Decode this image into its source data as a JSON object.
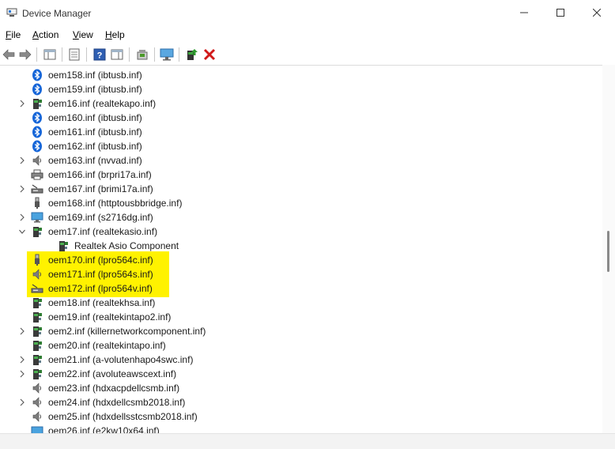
{
  "window": {
    "title": "Device Manager",
    "controls": {
      "minimize": "minimize-icon",
      "maximize": "maximize-icon",
      "close": "close-icon"
    }
  },
  "menu": [
    {
      "id": "file",
      "ul": "F",
      "rest": "ile"
    },
    {
      "id": "action",
      "ul": "A",
      "rest": "ction"
    },
    {
      "id": "view",
      "ul": "V",
      "rest": "iew"
    },
    {
      "id": "help",
      "ul": "H",
      "rest": "elp"
    }
  ],
  "toolbar": [
    {
      "id": "back",
      "icon": "back-arrow-icon"
    },
    {
      "id": "forward",
      "icon": "forward-arrow-icon"
    },
    {
      "id": "show-hide-console-tree",
      "icon": "console-tree-icon"
    },
    {
      "id": "properties",
      "icon": "properties-icon"
    },
    {
      "id": "help",
      "icon": "help-icon"
    },
    {
      "id": "action-pane",
      "icon": "action-pane-icon"
    },
    {
      "id": "update-driver",
      "icon": "update-driver-icon"
    },
    {
      "id": "scan-hardware",
      "icon": "monitor-scan-icon"
    },
    {
      "id": "enable-device",
      "icon": "enable-device-icon"
    },
    {
      "id": "uninstall-device",
      "icon": "uninstall-x-icon"
    }
  ],
  "tree": [
    {
      "label": "oem158.inf (ibtusb.inf)",
      "icon": "bluetooth",
      "level": 0,
      "expander": "none",
      "highlight": false
    },
    {
      "label": "oem159.inf (ibtusb.inf)",
      "icon": "bluetooth",
      "level": 0,
      "expander": "none",
      "highlight": false
    },
    {
      "label": "oem16.inf (realtekapo.inf)",
      "icon": "component",
      "level": 0,
      "expander": "collapsed",
      "highlight": false
    },
    {
      "label": "oem160.inf (ibtusb.inf)",
      "icon": "bluetooth",
      "level": 0,
      "expander": "none",
      "highlight": false
    },
    {
      "label": "oem161.inf (ibtusb.inf)",
      "icon": "bluetooth",
      "level": 0,
      "expander": "none",
      "highlight": false
    },
    {
      "label": "oem162.inf (ibtusb.inf)",
      "icon": "bluetooth",
      "level": 0,
      "expander": "none",
      "highlight": false
    },
    {
      "label": "oem163.inf (nvvad.inf)",
      "icon": "speaker",
      "level": 0,
      "expander": "collapsed",
      "highlight": false
    },
    {
      "label": "oem166.inf (brpri17a.inf)",
      "icon": "printer",
      "level": 0,
      "expander": "none",
      "highlight": false
    },
    {
      "label": "oem167.inf (brimi17a.inf)",
      "icon": "scanner",
      "level": 0,
      "expander": "collapsed",
      "highlight": false
    },
    {
      "label": "oem168.inf (httptousbbridge.inf)",
      "icon": "usb-plug",
      "level": 0,
      "expander": "none",
      "highlight": false
    },
    {
      "label": "oem169.inf (s2716dg.inf)",
      "icon": "monitor",
      "level": 0,
      "expander": "collapsed",
      "highlight": false
    },
    {
      "label": "oem17.inf (realtekasio.inf)",
      "icon": "component",
      "level": 0,
      "expander": "expanded",
      "highlight": false
    },
    {
      "label": "Realtek Asio Component",
      "icon": "component",
      "level": 1,
      "expander": "none",
      "highlight": false
    },
    {
      "label": "oem170.inf (lpro564c.inf)",
      "icon": "usb-plug",
      "level": 0,
      "expander": "none",
      "highlight": true
    },
    {
      "label": "oem171.inf (lpro564s.inf)",
      "icon": "speaker",
      "level": 0,
      "expander": "none",
      "highlight": true
    },
    {
      "label": "oem172.inf (lpro564v.inf)",
      "icon": "scanner",
      "level": 0,
      "expander": "none",
      "highlight": true
    },
    {
      "label": "oem18.inf (realtekhsa.inf)",
      "icon": "component",
      "level": 0,
      "expander": "none",
      "highlight": false
    },
    {
      "label": "oem19.inf (realtekintapo2.inf)",
      "icon": "component",
      "level": 0,
      "expander": "none",
      "highlight": false
    },
    {
      "label": "oem2.inf (killernetworkcomponent.inf)",
      "icon": "component",
      "level": 0,
      "expander": "collapsed",
      "highlight": false
    },
    {
      "label": "oem20.inf (realtekintapo.inf)",
      "icon": "component",
      "level": 0,
      "expander": "none",
      "highlight": false
    },
    {
      "label": "oem21.inf (a-volutenhapo4swc.inf)",
      "icon": "component",
      "level": 0,
      "expander": "collapsed",
      "highlight": false
    },
    {
      "label": "oem22.inf (avoluteawscext.inf)",
      "icon": "component",
      "level": 0,
      "expander": "collapsed",
      "highlight": false
    },
    {
      "label": "oem23.inf (hdxacpdellcsmb.inf)",
      "icon": "speaker",
      "level": 0,
      "expander": "none",
      "highlight": false
    },
    {
      "label": "oem24.inf (hdxdellcsmb2018.inf)",
      "icon": "speaker",
      "level": 0,
      "expander": "collapsed",
      "highlight": false
    },
    {
      "label": "oem25.inf (hdxdellsstcsmb2018.inf)",
      "icon": "speaker",
      "level": 0,
      "expander": "none",
      "highlight": false
    },
    {
      "label": "oem26.inf (e2kw10x64.inf)",
      "icon": "network",
      "level": 0,
      "expander": "none",
      "highlight": false
    }
  ],
  "colors": {
    "highlight": "#fff200",
    "bluetooth": "#1565d8",
    "delete": "#d11a1a"
  }
}
